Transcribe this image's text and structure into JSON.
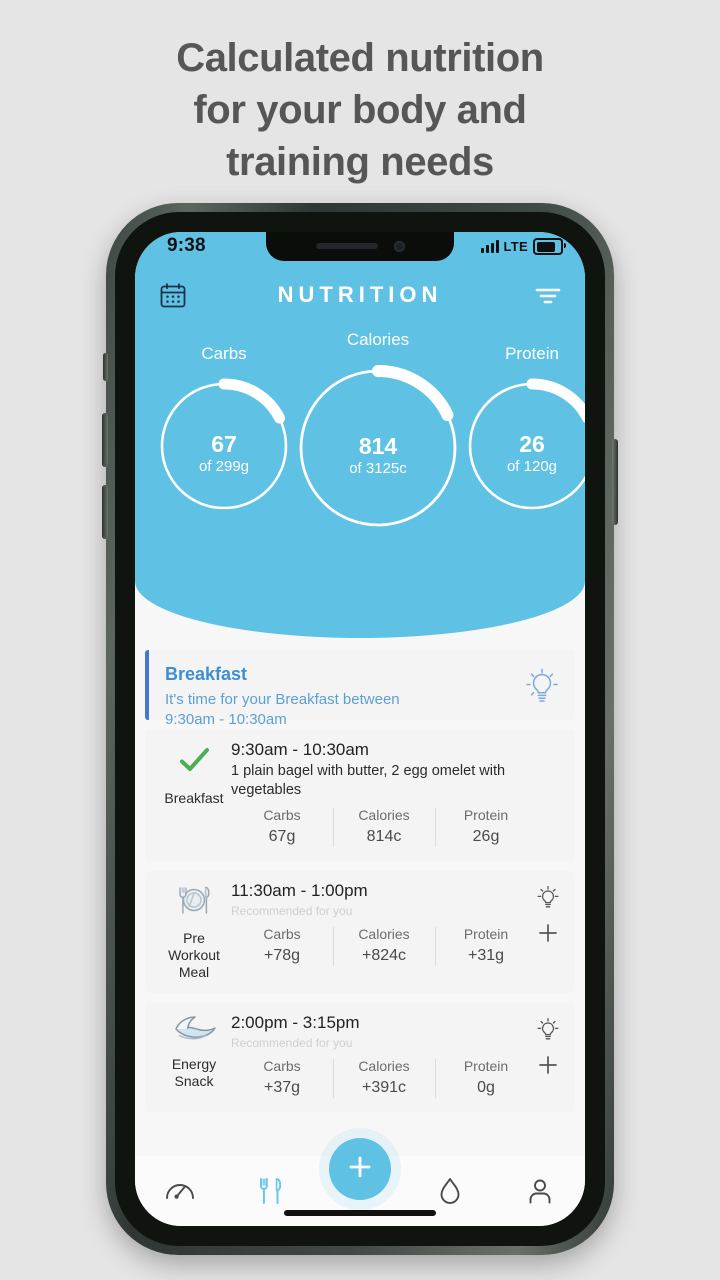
{
  "headline": {
    "line1": "Calculated nutrition",
    "line2": "for your body and",
    "line3": "training needs"
  },
  "colors": {
    "accent_blue": "#5fc2e5",
    "page_bg": "#e5e5e5",
    "screen_bg": "#f7f7f7",
    "tip_border": "#4477d4",
    "tip_title": "#3f8fd0",
    "check_green": "#4caf50"
  },
  "status_bar": {
    "time": "9:38",
    "network": "LTE",
    "signal_icon": "signal-bars-icon",
    "battery_icon": "battery-full-icon"
  },
  "app_bar": {
    "title": "NUTRITION",
    "calendar_icon": "calendar-icon",
    "filter_icon": "filter-icon"
  },
  "rings": [
    {
      "label": "Carbs",
      "value": "67",
      "goal": "of 299g",
      "percent": 22,
      "key": "carbs"
    },
    {
      "label": "Calories",
      "value": "814",
      "goal": "of 3125c",
      "percent": 26,
      "key": "calories"
    },
    {
      "label": "Protein",
      "value": "26",
      "goal": "of 120g",
      "percent": 22,
      "key": "protein"
    }
  ],
  "tip_card": {
    "title": "Breakfast",
    "body_line1": "It's time for your Breakfast between",
    "body_line2": "9:30am - 10:30am",
    "bulb_icon": "lightbulb-icon"
  },
  "meals": [
    {
      "name_line1": "Breakfast",
      "name_line2": "",
      "icon": "check-icon",
      "time": "9:30am - 10:30am",
      "description": "1 plain bagel with butter, 2 egg omelet with vegetables",
      "recommended": "",
      "macros": [
        {
          "header": "Carbs",
          "value": "67g"
        },
        {
          "header": "Calories",
          "value": "814c"
        },
        {
          "header": "Protein",
          "value": "26g"
        }
      ],
      "has_actions": false
    },
    {
      "name_line1": "Pre",
      "name_line2": "Workout Meal",
      "icon": "plate-cutlery-icon",
      "time": "11:30am - 1:00pm",
      "description": "",
      "recommended": "Recommended for you",
      "macros": [
        {
          "header": "Carbs",
          "value": "+78g"
        },
        {
          "header": "Calories",
          "value": "+824c"
        },
        {
          "header": "Protein",
          "value": "+31g"
        }
      ],
      "has_actions": true
    },
    {
      "name_line1": "Energy Snack",
      "name_line2": "",
      "icon": "banana-bowl-icon",
      "time": "2:00pm - 3:15pm",
      "description": "",
      "recommended": "Recommended for you",
      "macros": [
        {
          "header": "Carbs",
          "value": "+37g"
        },
        {
          "header": "Calories",
          "value": "+391c"
        },
        {
          "header": "Protein",
          "value": "0g"
        }
      ],
      "has_actions": true
    }
  ],
  "tab_bar": {
    "items": [
      {
        "icon": "dashboard-gauge-icon",
        "active": false
      },
      {
        "icon": "fork-knife-icon",
        "active": true
      },
      {
        "icon": "water-drop-icon",
        "active": false
      },
      {
        "icon": "person-icon",
        "active": false
      }
    ],
    "fab_icon": "plus-icon"
  }
}
